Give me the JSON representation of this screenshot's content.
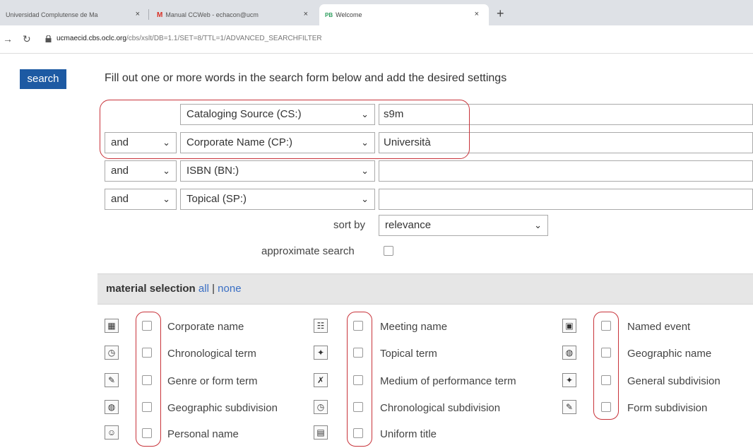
{
  "browser": {
    "tabs": [
      {
        "label": "Universidad Complutense de Ma"
      },
      {
        "label": "Manual CCWeb - echacon@ucm",
        "favicon": "M"
      },
      {
        "label": "Welcome",
        "favicon": "PB"
      }
    ],
    "new_tab": "+",
    "close": "×",
    "url_host": "ucmaecid.cbs.oclc.org",
    "url_path": "/cbs/xslt/DB=1.1/SET=8/TTL=1/ADVANCED_SEARCHFILTER"
  },
  "search_button": "search",
  "intro": "Fill out one or more words in the search form below and add the desired settings",
  "rows": [
    {
      "operator": "",
      "field": "Cataloging Source (CS:)",
      "value": "s9m"
    },
    {
      "operator": "and",
      "field": "Corporate Name (CP:)",
      "value": "Università"
    },
    {
      "operator": "and",
      "field": "ISBN (BN:)",
      "value": ""
    },
    {
      "operator": "and",
      "field": "Topical (SP:)",
      "value": ""
    }
  ],
  "sort": {
    "label": "sort by",
    "value": "relevance"
  },
  "approximate_label": "approximate search",
  "material": {
    "title": "material selection",
    "all": "all",
    "sep": "|",
    "none": "none"
  },
  "materials": {
    "col1": [
      "Corporate name",
      "Chronological term",
      "Genre or form term",
      "Geographic subdivision",
      "Personal name"
    ],
    "col2": [
      "Meeting name",
      "Topical term",
      "Medium of performance term",
      "Chronological subdivision",
      "Uniform title"
    ],
    "col3": [
      "Named event",
      "Geographic name",
      "General subdivision",
      "Form subdivision"
    ]
  },
  "colors": {
    "accent": "#1d5aa3",
    "annotation": "#c8333a",
    "link": "#3a6fc4"
  }
}
